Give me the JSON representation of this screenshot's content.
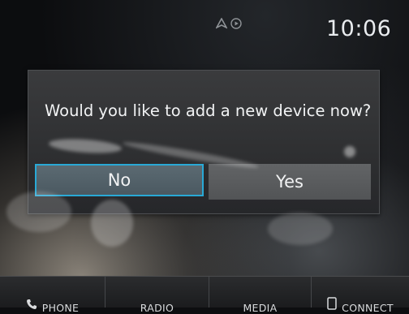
{
  "status_bar": {
    "time": "10:06",
    "icons": [
      "navigation-arrow-icon",
      "play-circle-icon"
    ]
  },
  "dialog": {
    "message": "Would you like to add a new device now?",
    "no_label": "No",
    "yes_label": "Yes",
    "selected": "No",
    "accent_color": "#29a9d6"
  },
  "nav_bar": {
    "items": [
      {
        "label": "PHONE",
        "icon": "phone-icon"
      },
      {
        "label": "RADIO"
      },
      {
        "label": "MEDIA"
      },
      {
        "label": "CONNECT",
        "icon": "phone-device-icon"
      }
    ]
  }
}
